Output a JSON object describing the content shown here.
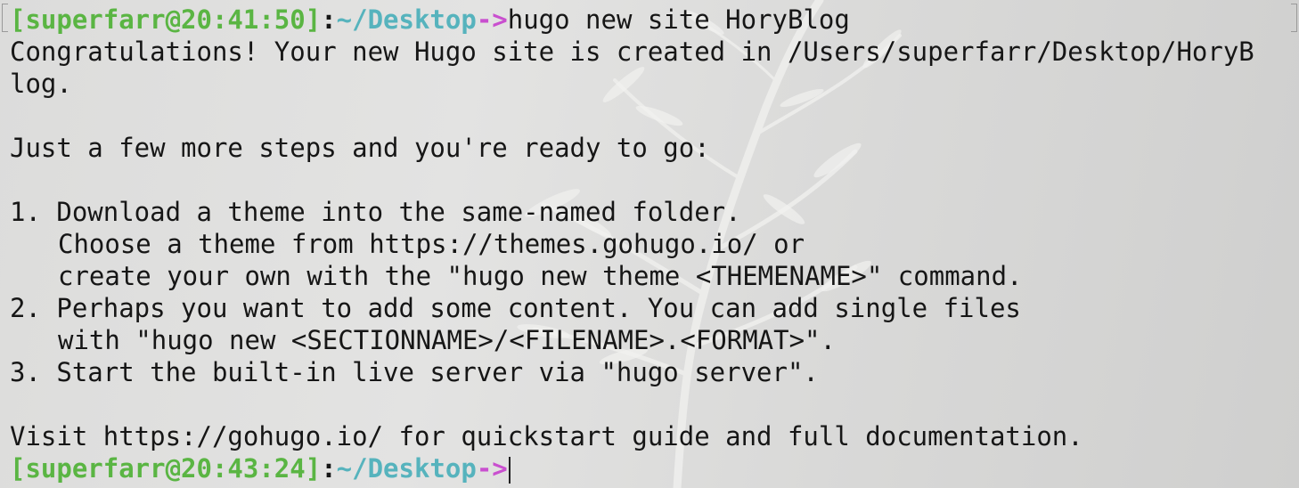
{
  "colors": {
    "prompt_bracket_user": "#5ab543",
    "prompt_path": "#56b3bd",
    "prompt_arrow": "#c94fcf",
    "text": "#161616"
  },
  "prompt1": {
    "user_time": "[superfarr@20:41:50]",
    "colon": ":",
    "path": "~/Desktop",
    "arrow": "->",
    "command": "hugo new site HoryBlog"
  },
  "output": {
    "line1": "Congratulations! Your new Hugo site is created in /Users/superfarr/Desktop/HoryB",
    "line2": "log.",
    "line3": "Just a few more steps and you're ready to go:",
    "step1": "1. Download a theme into the same-named folder.",
    "step1_b": "Choose a theme from https://themes.gohugo.io/ or",
    "step1_c": "create your own with the \"hugo new theme <THEMENAME>\" command.",
    "step2": "2. Perhaps you want to add some content. You can add single files",
    "step2_b": "with \"hugo new <SECTIONNAME>/<FILENAME>.<FORMAT>\".",
    "step3": "3. Start the built-in live server via \"hugo server\".",
    "visit": "Visit https://gohugo.io/ for quickstart guide and full documentation."
  },
  "prompt2": {
    "user_time": "[superfarr@20:43:24]",
    "colon": ":",
    "path": "~/Desktop",
    "arrow": "->",
    "command": ""
  }
}
